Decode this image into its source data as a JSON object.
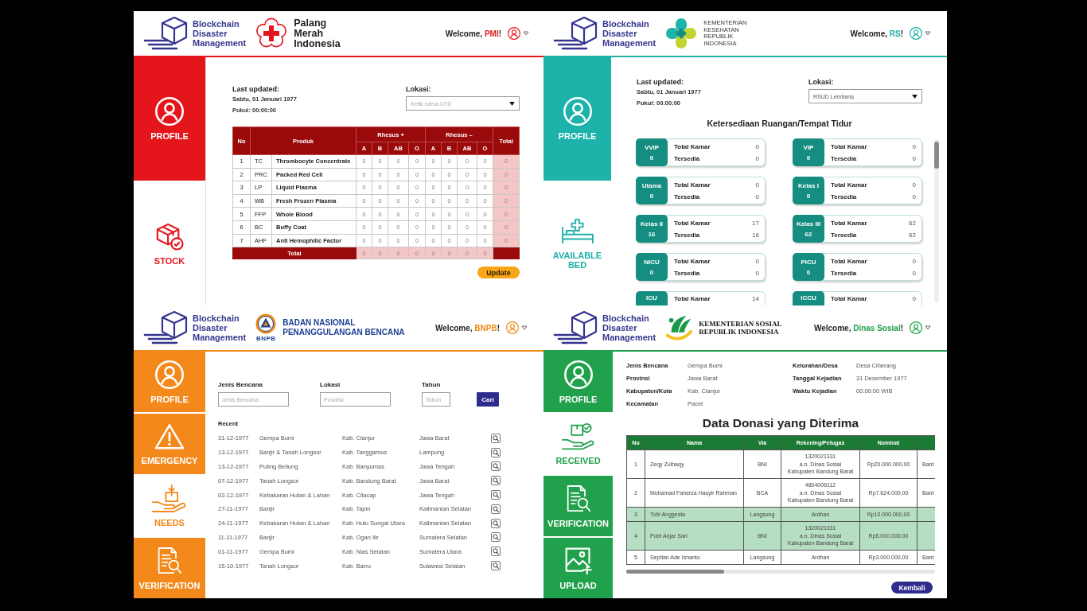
{
  "panels": [
    {
      "kind": "stock",
      "header": {
        "app_name": "Blockchain Disaster Management",
        "partner_name": "Palang Merah Indonesia",
        "greeting": "Welcome,",
        "user": "PMI",
        "punct": "!"
      },
      "sidebar": [
        {
          "kind": "profile",
          "label": "PROFILE",
          "selected": false
        },
        {
          "kind": "stock",
          "label": "STOCK",
          "selected": true
        }
      ],
      "last_updated": {
        "label": "Last updated:",
        "date": "Sabtu, 01 Januari 1977",
        "time": "Pukul: 00:00:00"
      },
      "location": {
        "label": "Lokasi:",
        "placeholder": "Ketik nama UTD"
      },
      "stock_table": {
        "headers": {
          "no": "No",
          "product": "Produk",
          "positive": "Rhesus +",
          "negative": "Rhesus –",
          "total": "Total"
        },
        "positive_types": [
          "A",
          "B",
          "AB",
          "O"
        ],
        "negative_types": [
          "A",
          "B",
          "AB",
          "O"
        ],
        "rows": [
          {
            "no": "1",
            "code": "TC",
            "name": "Thrombocyte Concentrate",
            "positive": [
              "0",
              "0",
              "0",
              "0"
            ],
            "negative": [
              "0",
              "0",
              "0",
              "0"
            ],
            "total": "0"
          },
          {
            "no": "2",
            "code": "PRC",
            "name": "Packed Red Cell",
            "positive": [
              "0",
              "0",
              "0",
              "0"
            ],
            "negative": [
              "0",
              "0",
              "0",
              "0"
            ],
            "total": "0"
          },
          {
            "no": "3",
            "code": "LP",
            "name": "Liquid Plasma",
            "positive": [
              "0",
              "0",
              "0",
              "0"
            ],
            "negative": [
              "0",
              "0",
              "0",
              "0"
            ],
            "total": "0"
          },
          {
            "no": "4",
            "code": "WB",
            "name": "Fresh Frozen Plasma",
            "positive": [
              "0",
              "0",
              "0",
              "0"
            ],
            "negative": [
              "0",
              "0",
              "0",
              "0"
            ],
            "total": "0"
          },
          {
            "no": "5",
            "code": "FFP",
            "name": "Whole Blood",
            "positive": [
              "0",
              "0",
              "0",
              "0"
            ],
            "negative": [
              "0",
              "0",
              "0",
              "0"
            ],
            "total": "0"
          },
          {
            "no": "6",
            "code": "BC",
            "name": "Buffy Coat",
            "positive": [
              "0",
              "0",
              "0",
              "0"
            ],
            "negative": [
              "0",
              "0",
              "0",
              "0"
            ],
            "total": "0"
          },
          {
            "no": "7",
            "code": "AHF",
            "name": "Anti Hemophilic Factor",
            "positive": [
              "0",
              "0",
              "0",
              "0"
            ],
            "negative": [
              "0",
              "0",
              "0",
              "0"
            ],
            "total": "0"
          }
        ],
        "total_row": {
          "label": "Total",
          "positive": [
            "0",
            "0",
            "0",
            "0"
          ],
          "negative": [
            "0",
            "0",
            "0",
            "0"
          ]
        }
      },
      "update_button": "Update"
    },
    {
      "kind": "beds",
      "header": {
        "app_name": "Blockchain Disaster Management",
        "partner_name": "KEMENTERIAN KESEHATAN REPUBLIK INDONESIA",
        "greeting": "Welcome,",
        "user": "RS",
        "punct": "!"
      },
      "sidebar": [
        {
          "kind": "profile",
          "label": "PROFILE",
          "selected": false
        },
        {
          "kind": "available_bed",
          "label": "AVAILABLE BED",
          "selected": true
        }
      ],
      "last_updated": {
        "label": "Last updated:",
        "date": "Sabtu, 01 Januari 1977",
        "time": "Pukul: 00:00:00"
      },
      "location": {
        "label": "Lokasi:",
        "value": "RSUD Lembang"
      },
      "title": "Ketersediaan Ruangan/Tempat Tidur",
      "rooms": [
        {
          "name": "VVIP",
          "count": "0",
          "rows": [
            {
              "label": "Total Kamar",
              "value": "0"
            },
            {
              "label": "Tersedia",
              "value": "0"
            }
          ]
        },
        {
          "name": "VIP",
          "count": "0",
          "rows": [
            {
              "label": "Total Kamar",
              "value": "0"
            },
            {
              "label": "Tersedia",
              "value": "0"
            }
          ]
        },
        {
          "name": "Utama",
          "count": "0",
          "rows": [
            {
              "label": "Total Kamar",
              "value": "0"
            },
            {
              "label": "Tersedia",
              "value": "0"
            }
          ]
        },
        {
          "name": "Kelas I",
          "count": "0",
          "rows": [
            {
              "label": "Total Kamar",
              "value": "0"
            },
            {
              "label": "Tersedia",
              "value": "0"
            }
          ]
        },
        {
          "name": "Kelas II",
          "count": "16",
          "rows": [
            {
              "label": "Total Kamar",
              "value": "17"
            },
            {
              "label": "Tersedia",
              "value": "16"
            }
          ]
        },
        {
          "name": "Kelas III",
          "count": "62",
          "rows": [
            {
              "label": "Total Kamar",
              "value": "62"
            },
            {
              "label": "Tersedia",
              "value": "62"
            }
          ]
        },
        {
          "name": "NICU",
          "count": "0",
          "rows": [
            {
              "label": "Total Kamar",
              "value": "0"
            },
            {
              "label": "Tersedia",
              "value": "0"
            }
          ]
        },
        {
          "name": "PICU",
          "count": "0",
          "rows": [
            {
              "label": "Total Kamar",
              "value": "0"
            },
            {
              "label": "Tersedia",
              "value": "0"
            }
          ]
        },
        {
          "name": "ICU",
          "rows": [
            {
              "label": "Total Kamar",
              "value": "14"
            }
          ]
        },
        {
          "name": "ICCU",
          "rows": [
            {
              "label": "Total Kamar",
              "value": "0"
            }
          ]
        }
      ]
    },
    {
      "kind": "disasters",
      "header": {
        "app_name": "Blockchain Disaster Management",
        "logo_caption": "BNPB",
        "partner_name": "BADAN NASIONAL PENANGGULANGAN BENCANA",
        "greeting": "Welcome,",
        "user": "BNPB",
        "punct": "!"
      },
      "sidebar": [
        {
          "kind": "profile",
          "label": "PROFILE",
          "selected": false
        },
        {
          "kind": "emergency",
          "label": "EMERGENCY",
          "selected": false
        },
        {
          "kind": "needs",
          "label": "NEEDS",
          "selected": true
        },
        {
          "kind": "verification",
          "label": "VERIFICATION",
          "selected": false
        }
      ],
      "filters": [
        {
          "label": "Jenis Bencana",
          "placeholder": "Jenis Bencana"
        },
        {
          "label": "Lokasi",
          "placeholder": "Provinsi"
        },
        {
          "label": "Tahun",
          "placeholder": "Tahun"
        }
      ],
      "search_button": "Cari",
      "recent_label": "Recent",
      "recent": [
        {
          "date": "31-12-1977",
          "type": "Gempa Bumi",
          "regency": "Kab. Cianjur",
          "province": "Jawa Barat"
        },
        {
          "date": "13-12-1977",
          "type": "Banjir & Tanah Longsor",
          "regency": "Kab. Tanggamus",
          "province": "Lampung"
        },
        {
          "date": "13-12-1977",
          "type": "Puting Beliung",
          "regency": "Kab. Banyumas",
          "province": "Jawa Tengah"
        },
        {
          "date": "07-12-1977",
          "type": "Tanah Longsor",
          "regency": "Kab. Bandung Barat",
          "province": "Jawa Barat"
        },
        {
          "date": "02-12-1977",
          "type": "Kebakaran Hutan & Lahan",
          "regency": "Kab. Cilacap",
          "province": "Jawa Tengah"
        },
        {
          "date": "27-11-1977",
          "type": "Banjir",
          "regency": "Kab. Tapin",
          "province": "Kalimantan Selatan"
        },
        {
          "date": "24-11-1977",
          "type": "Kebakaran Hutan & Lahan",
          "regency": "Kab. Hulu Sungai Utara",
          "province": "Kalimantan Selatan"
        },
        {
          "date": "11-11-1977",
          "type": "Banjir",
          "regency": "Kab. Ogan Ilir",
          "province": "Sumatera Selatan"
        },
        {
          "date": "01-11-1977",
          "type": "Gempa Bumi",
          "regency": "Kab. Nias Selatan",
          "province": "Sumatera Utara"
        },
        {
          "date": "15-10-1977",
          "type": "Tanah Longsor",
          "regency": "Kab. Barru",
          "province": "Sulawesi Selatan"
        }
      ]
    },
    {
      "kind": "donations",
      "header": {
        "app_name": "Blockchain Disaster Management",
        "partner_name": "KEMENTERIAN SOSIAL REPUBLIK INDONESIA",
        "greeting": "Welcome,",
        "user": "Dinas Sosial",
        "punct": "!"
      },
      "sidebar": [
        {
          "kind": "profile",
          "label": "PROFILE",
          "selected": false
        },
        {
          "kind": "received",
          "label": "RECEIVED",
          "selected": true
        },
        {
          "kind": "verification",
          "label": "VERIFICATION",
          "selected": false
        },
        {
          "kind": "upload",
          "label": "UPLOAD",
          "selected": false
        }
      ],
      "details_left": [
        {
          "label": "Jenis Bencana",
          "value": "Gempa Bumi"
        },
        {
          "label": "Provinsi",
          "value": "Jawa Barat"
        },
        {
          "label": "Kabupaten/Kota",
          "value": "Kab. Cianjur"
        },
        {
          "label": "Kecamatan",
          "value": "Pacet"
        }
      ],
      "details_right": [
        {
          "label": "Kelurahan/Desa",
          "value": "Desa Ciherang"
        },
        {
          "label": "Tanggal Kejadian",
          "value": "31 Desember 1977"
        },
        {
          "label": "Waktu Kejadian",
          "value": "00:00:00 WIB"
        }
      ],
      "title": "Data Donasi yang Diterima",
      "donations": {
        "columns": [
          "No",
          "Nama",
          "Via",
          "Rekening/Petugas",
          "Nominal"
        ],
        "rows": [
          {
            "no": "1",
            "name": "Zeqy Zulhaqy",
            "via": "BNI",
            "account": [
              "1320021331",
              "a.n. Dinas Sosial",
              "Kabupaten Bandung Barat"
            ],
            "nominal": "Rp20.000.000,00",
            "column_6": "Bant",
            "highlighted": false
          },
          {
            "no": "2",
            "name": "Mohamad Faherza Hasyir Rahman",
            "via": "BCA",
            "account": [
              "4804006112",
              "a.n. Dinas Sosial",
              "Kabupaten Bandung Barat"
            ],
            "nominal": "Rp7.624.000,00",
            "column_6": "Bant",
            "highlighted": false
          },
          {
            "no": "3",
            "name": "Tobi Anggesta",
            "via": "Langsung",
            "account": [
              "Ardhan"
            ],
            "nominal": "Rp10.000.000,00",
            "highlighted": true
          },
          {
            "no": "4",
            "name": "Putri Anjar Sari",
            "via": "BNI",
            "account": [
              "1320021331",
              "a.n. Dinas Sosial",
              "Kabupaten Bandung Barat"
            ],
            "nominal": "Rp5.000.000,00",
            "highlighted": true
          },
          {
            "no": "5",
            "name": "Septian Ade Isnanto",
            "via": "Langsung",
            "account": [
              "Ardhan"
            ],
            "nominal": "Rp3.000.000,00",
            "column_6": "Bant",
            "highlighted": false
          }
        ]
      },
      "back_button": "Kembali"
    }
  ]
}
